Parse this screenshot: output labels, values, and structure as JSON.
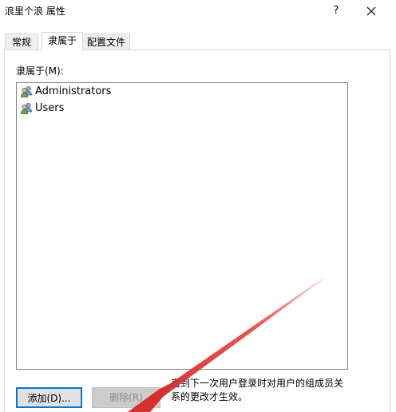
{
  "window": {
    "title": "浪里个浪 属性",
    "help_label": "?"
  },
  "tabs": [
    {
      "label": "常规"
    },
    {
      "label": "隶属于"
    },
    {
      "label": "配置文件"
    }
  ],
  "memberof": {
    "label": "隶属于(M):",
    "items": [
      {
        "label": "Administrators",
        "icon": "user-group-icon"
      },
      {
        "label": "Users",
        "icon": "user-group-icon"
      }
    ]
  },
  "buttons": {
    "add_label": "添加(D)...",
    "remove_label": "删除(R)"
  },
  "note": "直到下一次用户登录时对用户的组成员关系的更改才生效。",
  "colors": {
    "focus_border": "#0078d7",
    "arrow": "#e53935"
  }
}
